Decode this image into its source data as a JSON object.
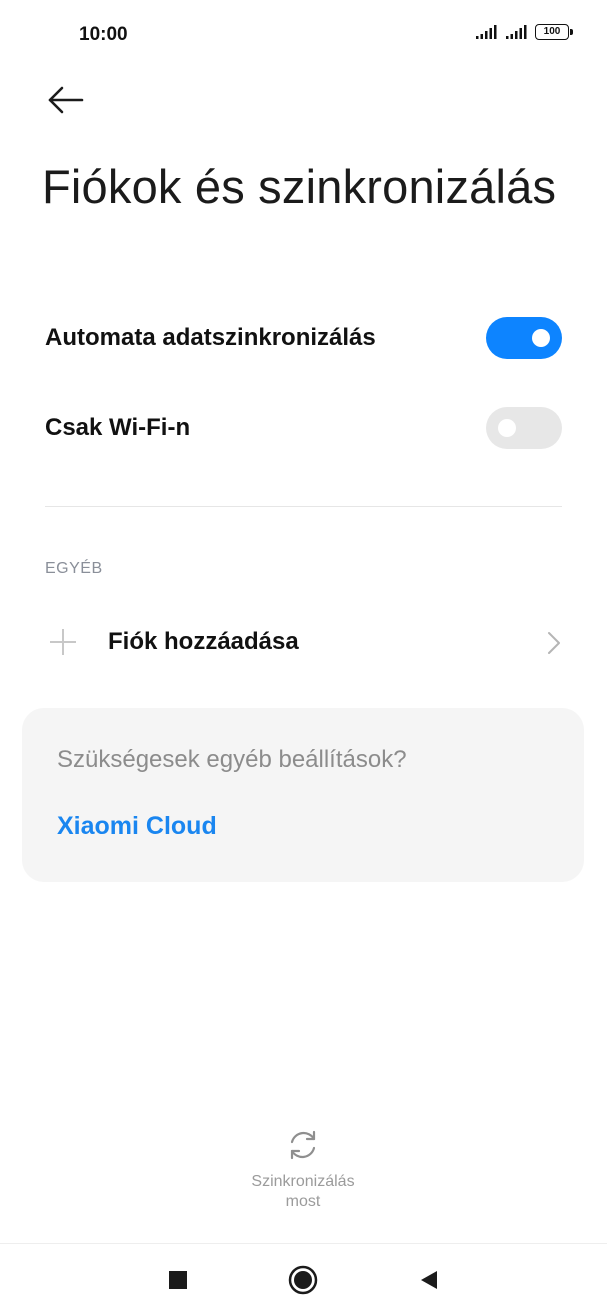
{
  "status_bar": {
    "time": "10:00",
    "battery": "100"
  },
  "header": {
    "back_icon": "arrow-left-icon",
    "title": "Fiókok és szinkronizálás"
  },
  "settings": {
    "auto_sync": {
      "label": "Automata adatszinkronizálás",
      "enabled": true
    },
    "wifi_only": {
      "label": "Csak Wi-Fi-n",
      "enabled": false
    }
  },
  "other_section": {
    "header": "EGYÉB",
    "add_account": {
      "label": "Fiók hozzáadása",
      "icon": "plus-icon"
    }
  },
  "help_card": {
    "question": "Szükségesek egyéb beállítások?",
    "link": "Xiaomi Cloud"
  },
  "sync_now": {
    "label_line1": "Szinkronizálás",
    "label_line2": "most",
    "icon": "sync-icon"
  },
  "colors": {
    "accent": "#0d84ff",
    "link": "#1a86f0",
    "toggle_off": "#e7e7e7",
    "card_bg": "#f5f5f5"
  }
}
